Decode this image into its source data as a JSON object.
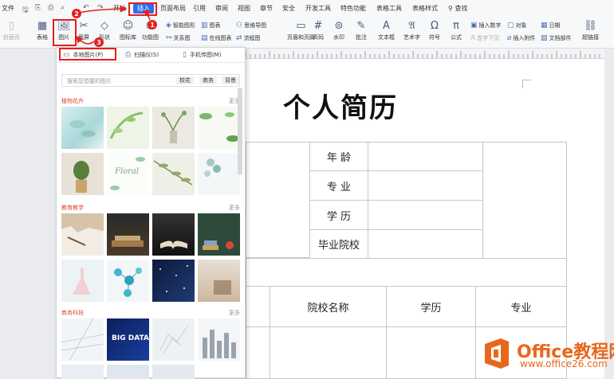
{
  "menubar": {
    "file": "文件",
    "items": [
      "开始",
      "插入",
      "页面布局",
      "引用",
      "审阅",
      "视图",
      "章节",
      "安全",
      "开发工具",
      "特色功能",
      "表格工具",
      "表格样式"
    ],
    "search": "查找"
  },
  "ribbon": {
    "cover_page": "封面页",
    "table": "表格",
    "picture": "图片",
    "screenshot": "截屏",
    "shapes": "形状",
    "icons": "图标库",
    "function_chart": "功能图",
    "smart_shape": "智能图形",
    "chart": "图表",
    "mind_map": "思维导图",
    "online_chart": "在线图表",
    "flowchart": "流程图",
    "relation_chart": "关系图",
    "header_footer": "页眉和页脚",
    "page_number": "页码",
    "watermark": "水印",
    "comment": "批注",
    "textbox": "文本框",
    "art_text": "艺术字",
    "symbol": "符号",
    "formula": "公式",
    "insert_number": "插入数字",
    "object": "对象",
    "date": "日期",
    "first_drop_cap": "首字下沉",
    "insert_attachment": "插入附件",
    "doc_parts": "文档部件",
    "hyperlink": "超链接"
  },
  "dropdown": {
    "sources": [
      "本地图片(P)",
      "扫描仪(S)",
      "手机传图(M)"
    ],
    "search_placeholder": "搜索您想要的图片",
    "chips": [
      "校花",
      "商务",
      "背景"
    ],
    "categories": [
      {
        "name": "植物花卉",
        "more": "更多"
      },
      {
        "name": "教育教学",
        "more": "更多"
      },
      {
        "name": "商务科技",
        "more": "更多"
      }
    ],
    "big_data_text": "BIG DATA",
    "floral_text": "Floral"
  },
  "annotations": [
    "1",
    "2",
    "3"
  ],
  "document": {
    "title": "个人简历",
    "labels": {
      "age": "年 龄",
      "major": "专 业",
      "education": "学 历",
      "school": "毕业院校"
    },
    "edu_headers": {
      "school_name": "院校名称",
      "degree": "学历",
      "major": "专业"
    }
  },
  "watermark": {
    "line1": "Office教程网",
    "line2": "www.office26.com"
  },
  "colors": {
    "accent": "#2c6ef2",
    "annotation": "#e3201b",
    "category": "#e0452e",
    "watermark": "#e8671c"
  }
}
